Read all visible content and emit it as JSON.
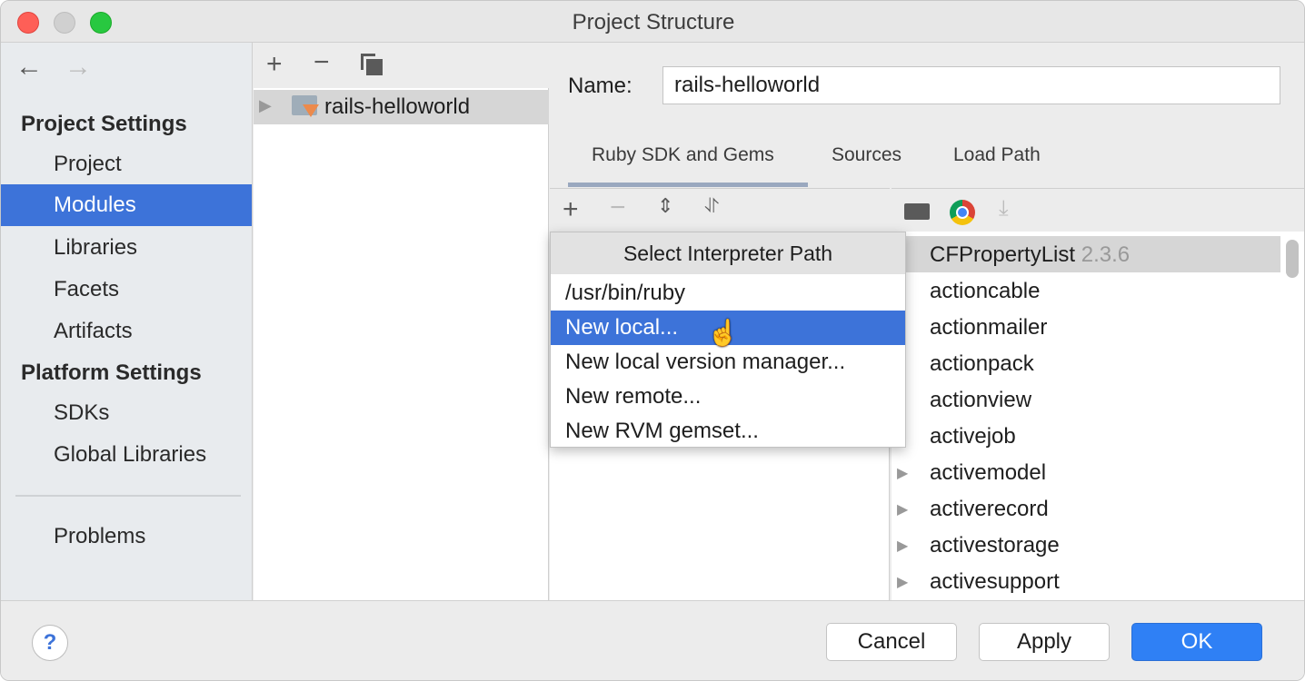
{
  "window": {
    "title": "Project Structure"
  },
  "sidebar": {
    "back": "←",
    "forward": "→",
    "project_settings": "Project Settings",
    "items": [
      {
        "label": "Project"
      },
      {
        "label": "Modules"
      },
      {
        "label": "Libraries"
      },
      {
        "label": "Facets"
      },
      {
        "label": "Artifacts"
      }
    ],
    "platform_settings": "Platform Settings",
    "platform_items": [
      {
        "label": "SDKs"
      },
      {
        "label": "Global Libraries"
      }
    ],
    "problems": "Problems",
    "selected": "Modules"
  },
  "modules": {
    "items": [
      {
        "label": "rails-helloworld"
      }
    ]
  },
  "details": {
    "name_label": "Name:",
    "name_value": "rails-helloworld",
    "tabs": [
      {
        "label": "Ruby SDK and Gems"
      },
      {
        "label": "Sources"
      },
      {
        "label": "Load Path"
      }
    ],
    "active_tab": "Ruby SDK and Gems"
  },
  "gems": [
    {
      "name": "CFPropertyList",
      "version": "2.3.6"
    },
    {
      "name": "actioncable"
    },
    {
      "name": "actionmailer"
    },
    {
      "name": "actionpack"
    },
    {
      "name": "actionview"
    },
    {
      "name": "activejob"
    },
    {
      "name": "activemodel"
    },
    {
      "name": "activerecord"
    },
    {
      "name": "activestorage"
    },
    {
      "name": "activesupport"
    }
  ],
  "popup": {
    "title": "Select Interpreter Path",
    "items": [
      {
        "label": "/usr/bin/ruby"
      },
      {
        "label": "New local..."
      },
      {
        "label": "New local version manager..."
      },
      {
        "label": "New remote..."
      },
      {
        "label": "New RVM gemset..."
      }
    ],
    "highlighted": "New local..."
  },
  "footer": {
    "help": "?",
    "cancel": "Cancel",
    "apply": "Apply",
    "ok": "OK"
  },
  "colors": {
    "accent": "#3d73d9",
    "chrome_tab_underline": "#9aa8bf"
  }
}
